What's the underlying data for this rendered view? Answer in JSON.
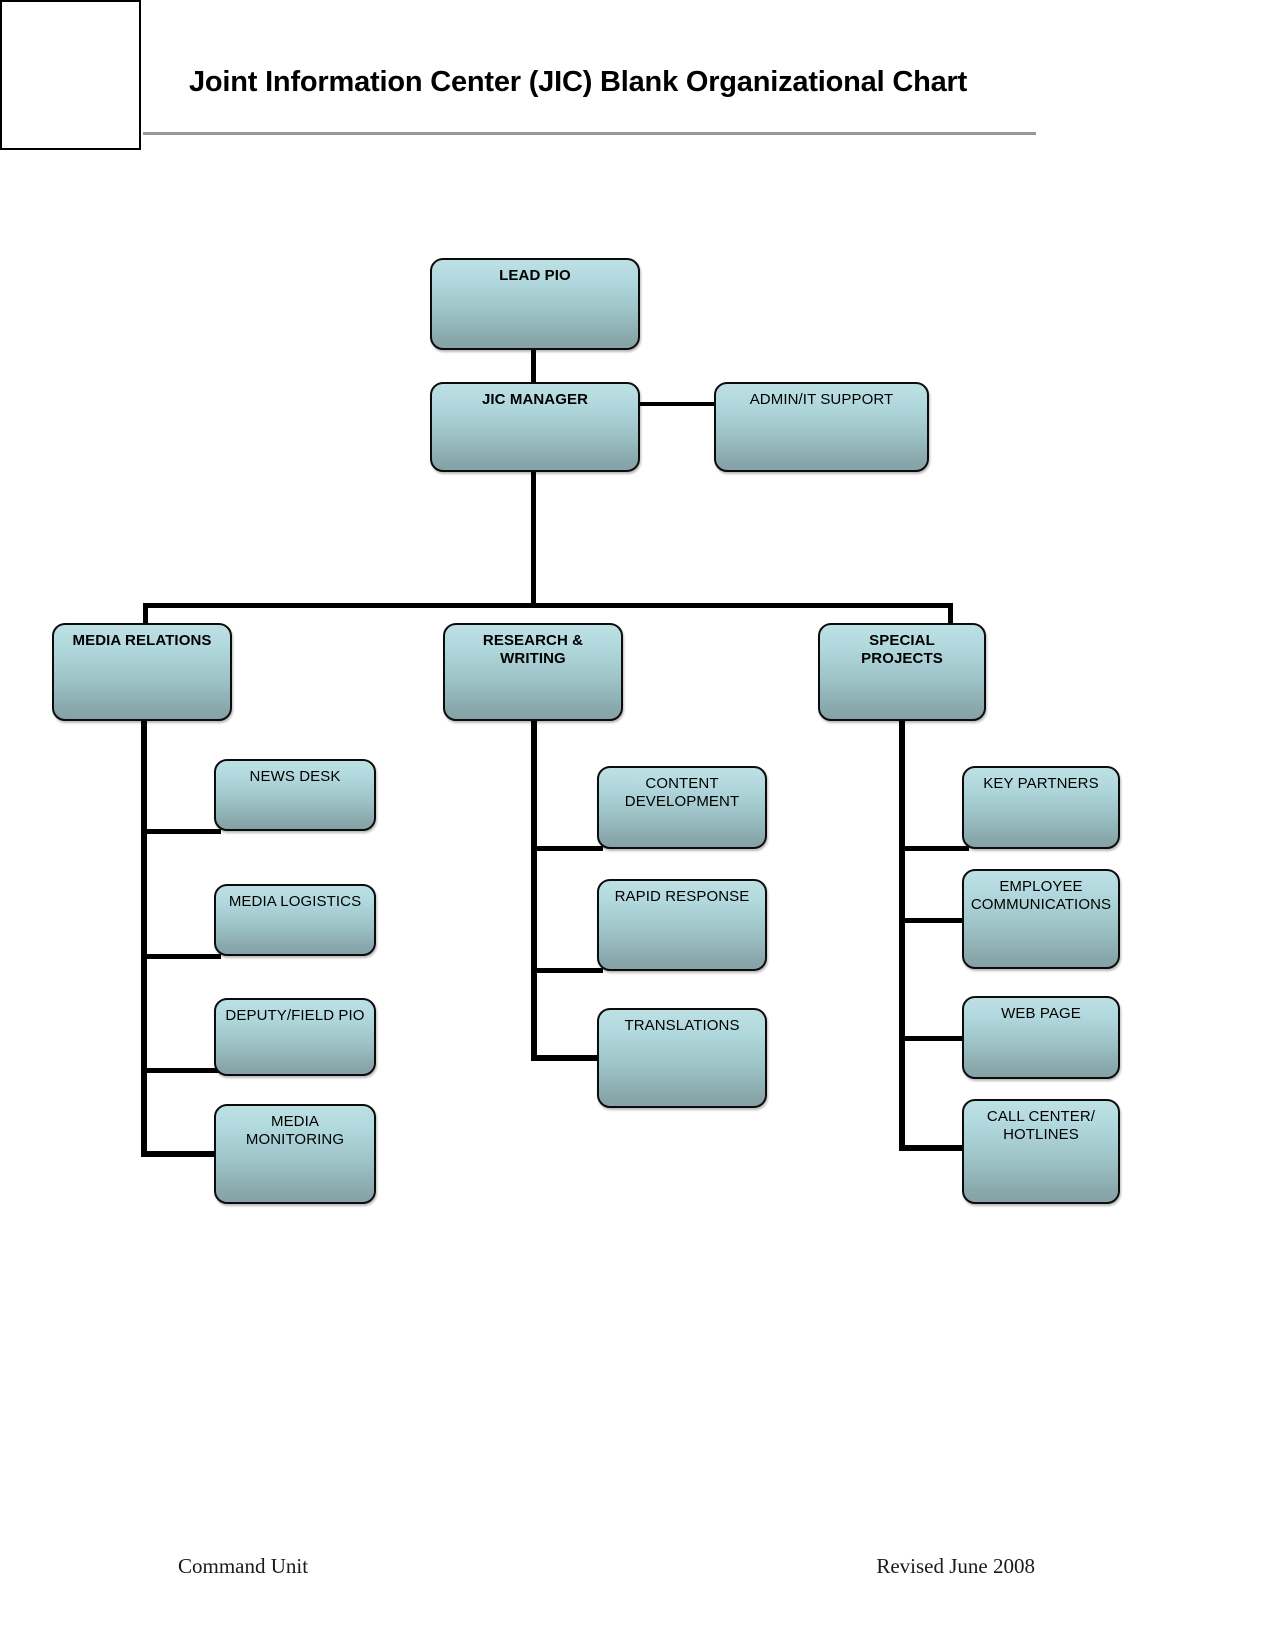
{
  "document": {
    "title": "Joint Information Center (JIC) Blank Organizational Chart",
    "footer_left": "Command Unit",
    "footer_right": "Revised June 2008"
  },
  "theme": {
    "box_fill_top": "#bde0e4",
    "box_fill_bottom": "#85a3a7",
    "box_border": "#0c0c0c",
    "connector": "#000000",
    "divider": "#989898",
    "text": "#000000",
    "page_background": "#ffffff"
  },
  "chart_data": {
    "type": "diagram",
    "diagram_type": "organizational-chart",
    "title": "Joint Information Center (JIC) Blank Organizational Chart",
    "orientation": "top-down",
    "nodes": [
      {
        "id": "lead_pio",
        "label": "LEAD PIO",
        "level": "top",
        "bold": true
      },
      {
        "id": "jic_manager",
        "label": "JIC MANAGER",
        "level": "top",
        "bold": true
      },
      {
        "id": "admin_it_support",
        "label": "ADMIN/IT SUPPORT",
        "level": "support",
        "bold": false
      },
      {
        "id": "media_relations",
        "label": "MEDIA RELATIONS",
        "level": "division",
        "bold": true
      },
      {
        "id": "research_writing",
        "label": "RESEARCH &\nWRITING",
        "level": "division",
        "bold": true
      },
      {
        "id": "special_projects",
        "label": "SPECIAL\nPROJECTS",
        "level": "division",
        "bold": true
      },
      {
        "id": "news_desk",
        "label": "NEWS DESK",
        "level": "unit",
        "bold": false
      },
      {
        "id": "media_logistics",
        "label": "MEDIA LOGISTICS",
        "level": "unit",
        "bold": false
      },
      {
        "id": "deputy_field_pio",
        "label": "DEPUTY/FIELD PIO",
        "level": "unit",
        "bold": false
      },
      {
        "id": "media_monitoring",
        "label": "MEDIA\nMONITORING",
        "level": "unit",
        "bold": false
      },
      {
        "id": "content_development",
        "label": "CONTENT\nDEVELOPMENT",
        "level": "unit",
        "bold": false
      },
      {
        "id": "rapid_response",
        "label": "RAPID RESPONSE",
        "level": "unit",
        "bold": false
      },
      {
        "id": "translations",
        "label": "TRANSLATIONS",
        "level": "unit",
        "bold": false
      },
      {
        "id": "key_partners",
        "label": "KEY PARTNERS",
        "level": "unit",
        "bold": false
      },
      {
        "id": "employee_communications",
        "label": "EMPLOYEE\nCOMMUNICATIONS",
        "level": "unit",
        "bold": false
      },
      {
        "id": "web_page",
        "label": "WEB PAGE",
        "level": "unit",
        "bold": false
      },
      {
        "id": "call_center_hotlines",
        "label": "CALL CENTER/\nHOTLINES",
        "level": "unit",
        "bold": false
      }
    ],
    "edges": [
      {
        "from": "lead_pio",
        "to": "jic_manager",
        "style": "vertical"
      },
      {
        "from": "jic_manager",
        "to": "admin_it_support",
        "style": "horizontal"
      },
      {
        "from": "jic_manager",
        "to": "media_relations",
        "style": "elbow"
      },
      {
        "from": "jic_manager",
        "to": "research_writing",
        "style": "vertical"
      },
      {
        "from": "jic_manager",
        "to": "special_projects",
        "style": "elbow"
      },
      {
        "from": "media_relations",
        "to": "news_desk",
        "style": "elbow"
      },
      {
        "from": "media_relations",
        "to": "media_logistics",
        "style": "elbow"
      },
      {
        "from": "media_relations",
        "to": "deputy_field_pio",
        "style": "elbow"
      },
      {
        "from": "media_relations",
        "to": "media_monitoring",
        "style": "elbow"
      },
      {
        "from": "research_writing",
        "to": "content_development",
        "style": "elbow"
      },
      {
        "from": "research_writing",
        "to": "rapid_response",
        "style": "elbow"
      },
      {
        "from": "research_writing",
        "to": "translations",
        "style": "elbow"
      },
      {
        "from": "special_projects",
        "to": "key_partners",
        "style": "elbow"
      },
      {
        "from": "special_projects",
        "to": "employee_communications",
        "style": "elbow"
      },
      {
        "from": "special_projects",
        "to": "web_page",
        "style": "elbow"
      },
      {
        "from": "special_projects",
        "to": "call_center_hotlines",
        "style": "elbow"
      }
    ],
    "branches": [
      {
        "division": "MEDIA RELATIONS",
        "units": [
          "NEWS DESK",
          "MEDIA LOGISTICS",
          "DEPUTY/FIELD PIO",
          "MEDIA MONITORING"
        ]
      },
      {
        "division": "RESEARCH & WRITING",
        "units": [
          "CONTENT DEVELOPMENT",
          "RAPID RESPONSE",
          "TRANSLATIONS"
        ]
      },
      {
        "division": "SPECIAL PROJECTS",
        "units": [
          "KEY PARTNERS",
          "EMPLOYEE COMMUNICATIONS",
          "WEB PAGE",
          "CALL CENTER/ HOTLINES"
        ]
      }
    ]
  }
}
